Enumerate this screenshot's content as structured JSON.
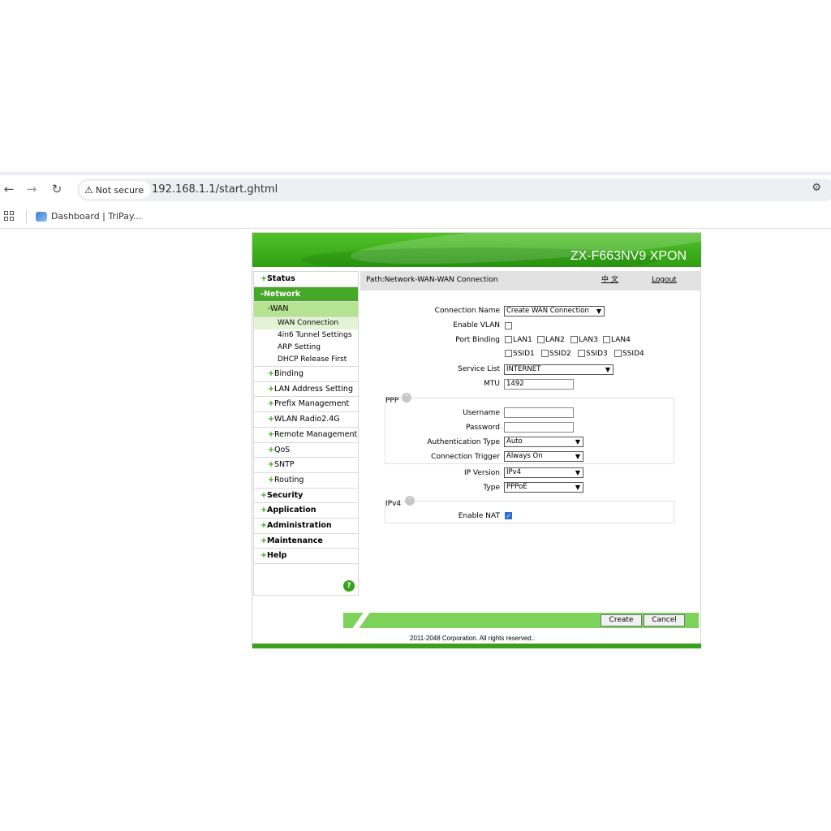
{
  "browser": {
    "security_label": "Not secure",
    "url": "192.168.1.1/start.ghtml",
    "bookmark_label": "Dashboard | TriPay..."
  },
  "router": {
    "model": "ZX-F663NV9 XPON",
    "path": "Path:Network-WAN-WAN Connection",
    "lang_link": "中 文",
    "logout": "Logout",
    "menu": {
      "status": "Status",
      "network": "Network",
      "wan": "WAN",
      "wan_connection": "WAN Connection",
      "tunnel": "4in6 Tunnel Settings",
      "arp": "ARP Setting",
      "dhcp_release": "DHCP Release First",
      "binding": "Binding",
      "lan": "LAN Address Setting",
      "prefix": "Prefix Management",
      "wlan": "WLAN Radio2.4G",
      "remote": "Remote Management",
      "qos": "QoS",
      "sntp": "SNTP",
      "routing": "Routing",
      "security": "Security",
      "application": "Application",
      "administration": "Administration",
      "maintenance": "Maintenance",
      "help": "Help",
      "plus": "+",
      "minus": "-"
    },
    "form": {
      "connection_name_label": "Connection Name",
      "connection_name_value": "Create WAN Connection",
      "enable_vlan_label": "Enable VLAN",
      "enable_vlan": false,
      "port_binding_label": "Port Binding",
      "ports": [
        "LAN1",
        "LAN2",
        "LAN3",
        "LAN4",
        "SSID1",
        "SSID2",
        "SSID3",
        "SSID4"
      ],
      "service_list_label": "Service List",
      "service_list_value": "INTERNET",
      "mtu_label": "MTU",
      "mtu_value": "1492",
      "ppp_title": "PPP",
      "username_label": "Username",
      "username_value": "",
      "password_label": "Password",
      "password_value": "",
      "auth_type_label": "Authentication Type",
      "auth_type_value": "Auto",
      "conn_trigger_label": "Connection Trigger",
      "conn_trigger_value": "Always On",
      "ip_version_label": "IP Version",
      "ip_version_value": "IPv4",
      "type_label": "Type",
      "type_value": "PPPoE",
      "ipv4_title": "IPv4",
      "enable_nat_label": "Enable NAT",
      "enable_nat": true
    },
    "buttons": {
      "create": "Create",
      "cancel": "Cancel"
    },
    "copyright": "2011-2048 Corporation. All rights reserved.."
  }
}
